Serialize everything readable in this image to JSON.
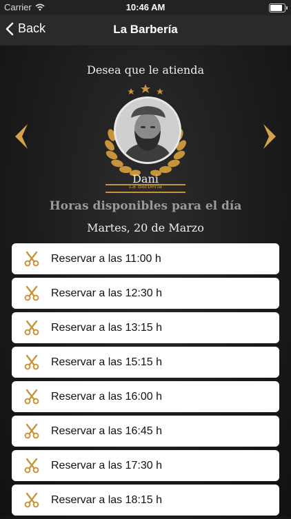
{
  "status_bar": {
    "carrier": "Carrier",
    "time": "10:46 AM",
    "battery_level": 0.9
  },
  "nav": {
    "back_label": "Back",
    "title": "La Barbería"
  },
  "barber": {
    "prompt": "Desea que le atienda",
    "name": "Dani",
    "shop": "La Barbería"
  },
  "schedule": {
    "title": "Horas disponibles para el día",
    "date": "Martes, 20 de Marzo"
  },
  "slots": [
    {
      "label": "Reservar a las 11:00 h"
    },
    {
      "label": "Reservar a las 12:30 h"
    },
    {
      "label": "Reservar a las 13:15 h"
    },
    {
      "label": "Reservar a las 15:15 h"
    },
    {
      "label": "Reservar a las 16:00 h"
    },
    {
      "label": "Reservar a las 16:45 h"
    },
    {
      "label": "Reservar a las 17:30 h"
    },
    {
      "label": "Reservar a las 18:15 h"
    }
  ],
  "colors": {
    "accent": "#c8943a",
    "background": "#1e1e1e",
    "nav": "#2a2a2a",
    "slot": "#ffffff"
  },
  "icons": {
    "back": "chevron-left-icon",
    "prev": "arrow-left-icon",
    "next": "arrow-right-icon",
    "slot": "scissors-icon"
  }
}
